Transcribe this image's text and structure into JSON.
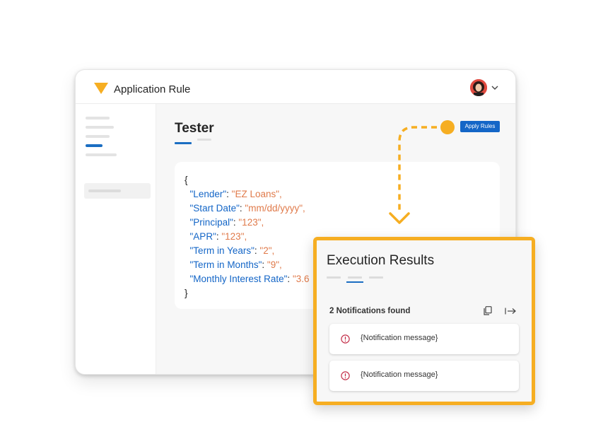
{
  "app": {
    "title": "Application Rule",
    "brand_color": "#f6ae22",
    "accent_color": "#1466c7"
  },
  "header": {
    "avatar_icon": "user-avatar",
    "menu_icon": "chevron-down-icon"
  },
  "sidebar": {
    "active_index": 3,
    "item_count": 5
  },
  "tester": {
    "title": "Tester",
    "apply_button_label": "Apply Rules",
    "code_lines": [
      {
        "key": "",
        "value": "",
        "text": "{"
      },
      {
        "key": "\"Lender\"",
        "value": "\"EZ Loans\","
      },
      {
        "key": "\"Start Date\"",
        "value": "\"mm/dd/yyyy\","
      },
      {
        "key": "\"Principal\"",
        "value": "\"123\","
      },
      {
        "key": "\"APR\"",
        "value": "\"123\","
      },
      {
        "key": "\"Term in Years\"",
        "value": "\"2\","
      },
      {
        "key": "\"Term in Months\"",
        "value": "\"9\","
      },
      {
        "key": "\"Monthly Interest Rate\"",
        "value": "\"3.6"
      },
      {
        "key": "",
        "value": "",
        "text": "}"
      }
    ]
  },
  "results": {
    "title": "Execution Results",
    "count_label": "2 Notifications found",
    "copy_icon": "copy-icon",
    "export_icon": "export-icon",
    "notifications": [
      {
        "icon": "error-circle-icon",
        "message": "{Notification message}"
      },
      {
        "icon": "error-circle-icon",
        "message": "{Notification message}"
      }
    ]
  }
}
